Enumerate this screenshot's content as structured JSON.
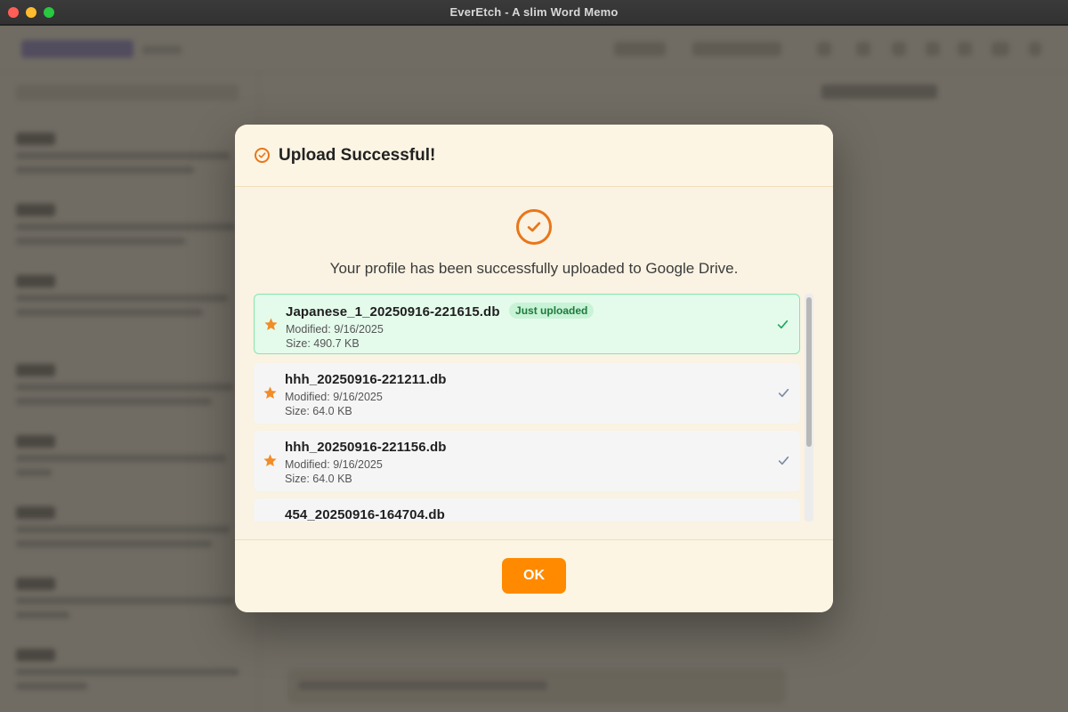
{
  "window": {
    "title": "EverEtch - A slim Word Memo"
  },
  "dialog": {
    "title": "Upload Successful!",
    "header_icon": "check-circle-icon",
    "message": "Your profile has been successfully uploaded to Google Drive.",
    "ok_label": "OK",
    "accent_color": "#ff8a00",
    "files": [
      {
        "name": "Japanese_1_20250916-221615.db",
        "badge": "Just uploaded",
        "modified": "Modified: 9/16/2025",
        "size": "Size: 490.7 KB",
        "highlighted": true
      },
      {
        "name": "hhh_20250916-221211.db",
        "modified": "Modified: 9/16/2025",
        "size": "Size: 64.0 KB"
      },
      {
        "name": "hhh_20250916-221156.db",
        "modified": "Modified: 9/16/2025",
        "size": "Size: 64.0 KB"
      },
      {
        "name": "454_20250916-164704.db"
      }
    ]
  }
}
